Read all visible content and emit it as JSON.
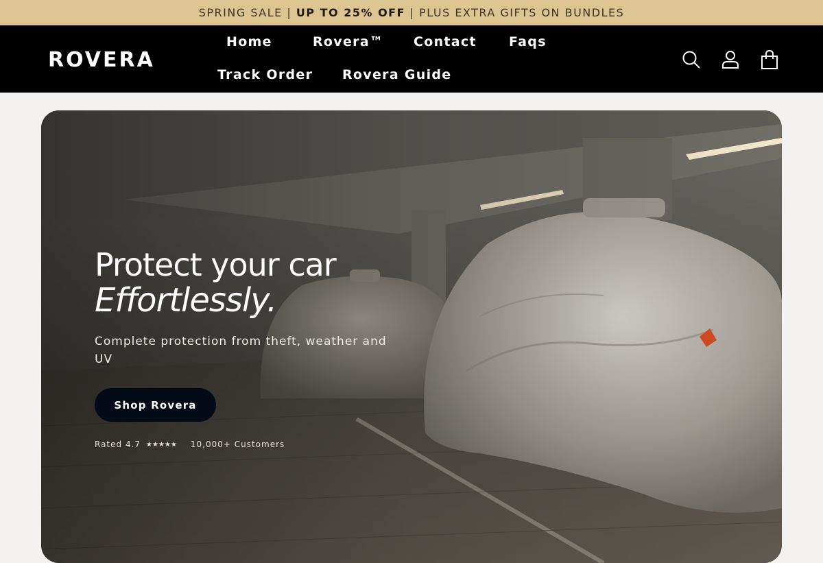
{
  "announcement": {
    "prefix": "SPRING SALE | ",
    "highlight": "UP TO 25% OFF",
    "suffix": " | PLUS EXTRA GIFTS ON BUNDLES"
  },
  "header": {
    "logo": "ROVERA",
    "nav": [
      "Home",
      "Rovera™",
      "Contact",
      "Faqs",
      "Track Order",
      "Rovera Guide"
    ],
    "icons": [
      "search-icon",
      "account-icon",
      "cart-icon"
    ]
  },
  "hero": {
    "title_line1": "Protect your car",
    "title_line2": "Effortlessly.",
    "subtitle": "Complete protection from theft, weather and UV",
    "cta": "Shop Rovera",
    "rating_text": "Rated 4.7",
    "stars": "★★★★★",
    "customers": "10,000+ Customers"
  },
  "colors": {
    "announcement_bg": "#dcc591",
    "header_bg": "#000000",
    "cta_bg": "#050a19",
    "page_bg": "#f3f2f0"
  }
}
